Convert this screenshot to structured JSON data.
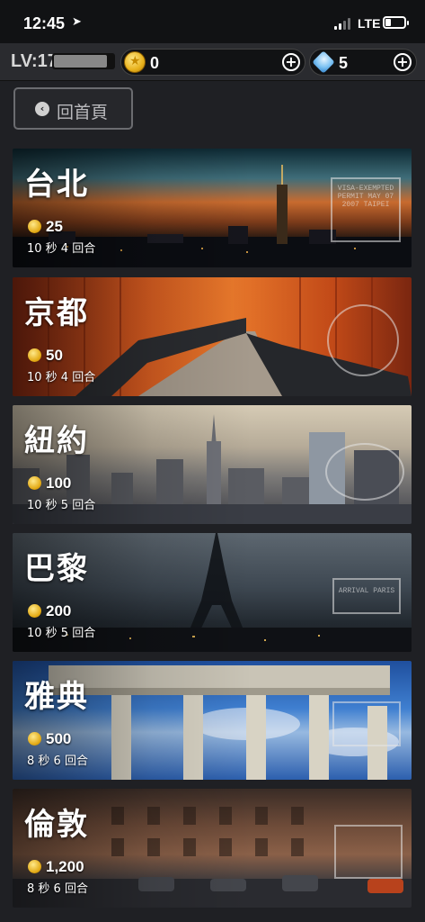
{
  "status_bar": {
    "time": "12:45",
    "network": "LTE"
  },
  "top_bar": {
    "level_label": "LV:17",
    "xp_progress": 0.9,
    "coins": "0",
    "gems": "5",
    "coin_icon": "coin-icon",
    "gem_icon": "diamond-icon",
    "add_icon": "plus-circle-icon"
  },
  "back_button": {
    "label": "回首頁",
    "icon": "chevron-left-circle-icon"
  },
  "cities": [
    {
      "name": "台北",
      "fee": "25",
      "rule": "10 秒 4 回合",
      "stamp": "VISA-EXEMPTED PERMIT  MAY 07 2007  TAIPEI"
    },
    {
      "name": "京都",
      "fee": "50",
      "rule": "10 秒 4 回合",
      "stamp": ""
    },
    {
      "name": "紐約",
      "fee": "100",
      "rule": "10 秒 5 回合",
      "stamp": ""
    },
    {
      "name": "巴黎",
      "fee": "200",
      "rule": "10 秒 5 回合",
      "stamp": "ARRIVAL  PARIS"
    },
    {
      "name": "雅典",
      "fee": "500",
      "rule": "8 秒 6 回合",
      "stamp": ""
    },
    {
      "name": "倫敦",
      "fee": "1,200",
      "rule": "8 秒 6 回合",
      "stamp": ""
    }
  ],
  "colors": {
    "background": "#1f2024",
    "topbar": "#2a2b2f",
    "coin": "#e8b21c"
  }
}
